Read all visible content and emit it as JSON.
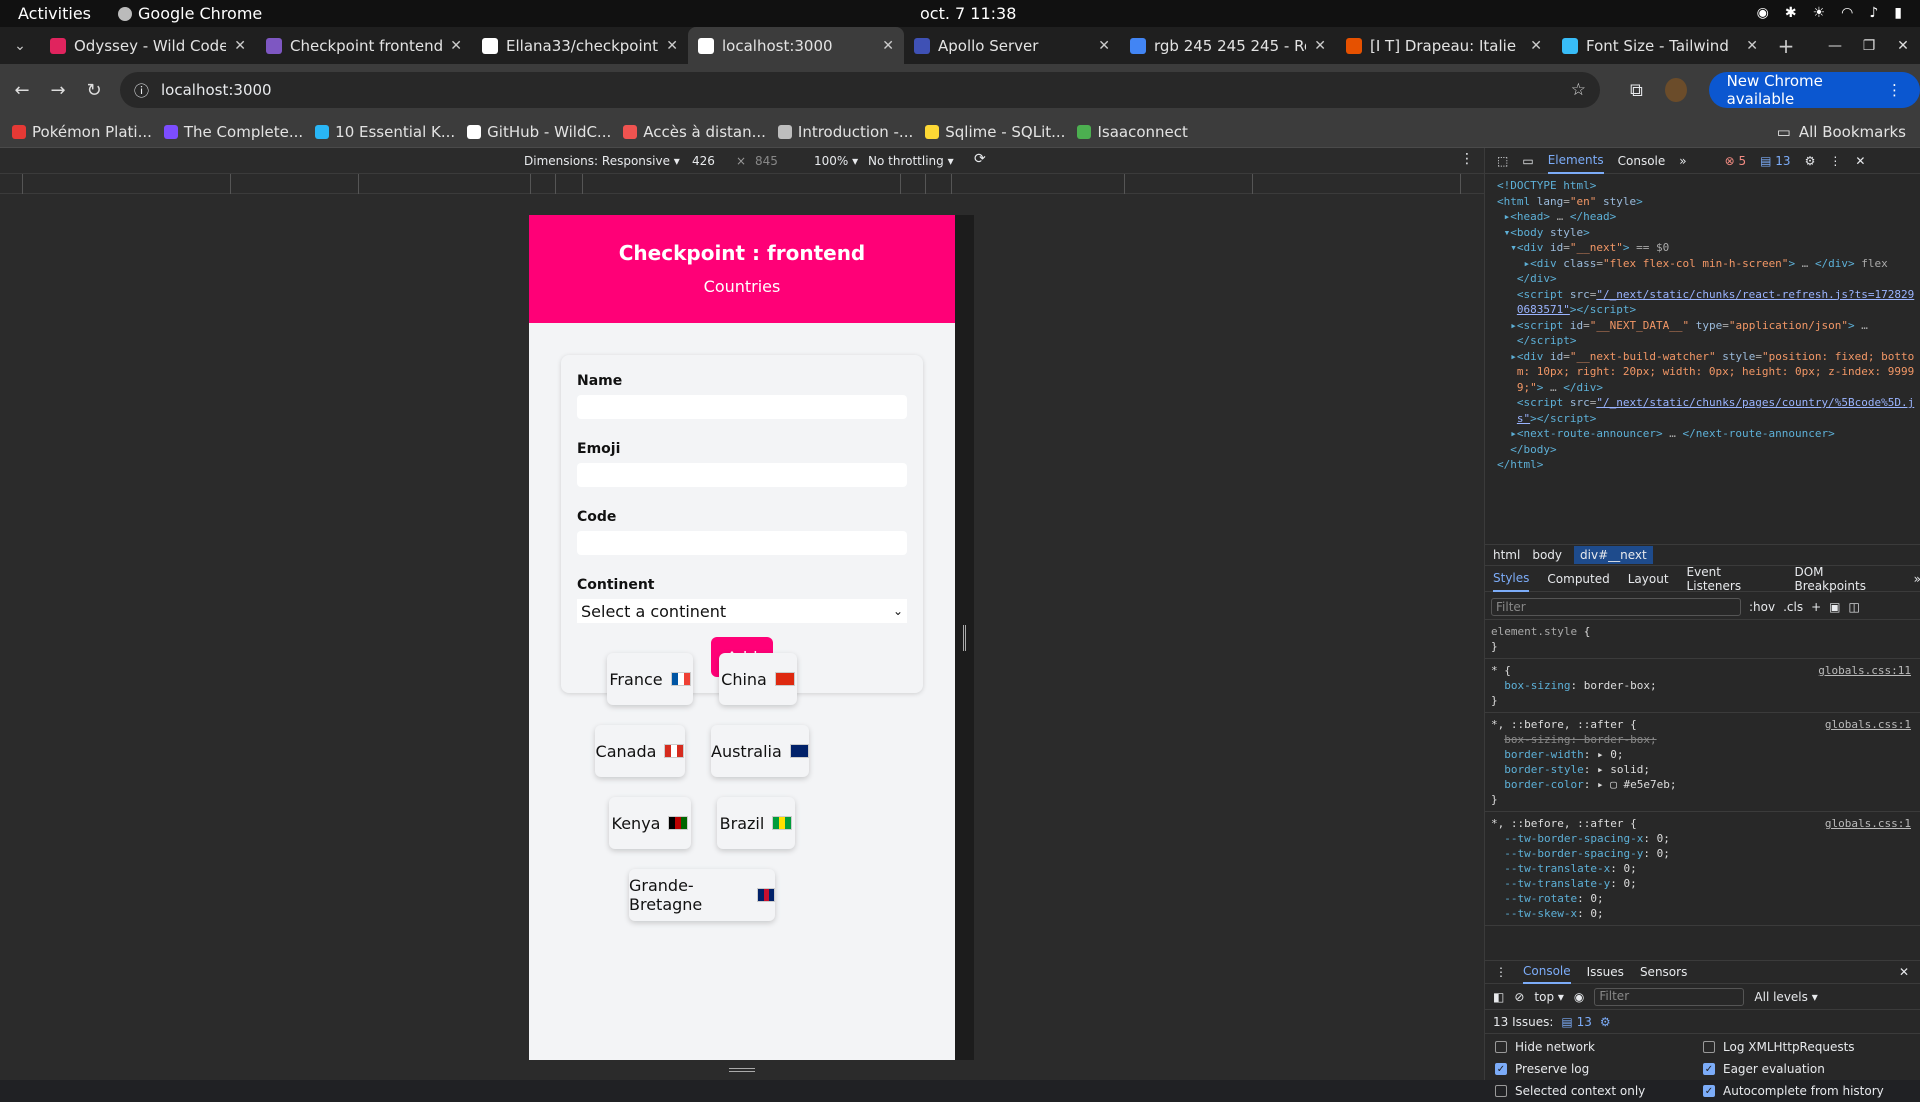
{
  "system": {
    "activities": "Activities",
    "app_name": "Google Chrome",
    "clock": "oct. 7  11:38"
  },
  "tabs": [
    {
      "title": "Odyssey - Wild Code",
      "color": "#e0245e"
    },
    {
      "title": "Checkpoint frontend",
      "color": "#7e57c2"
    },
    {
      "title": "Ellana33/checkpoint",
      "color": "#ffffff"
    },
    {
      "title": "localhost:3000",
      "color": "#ffffff",
      "active": true
    },
    {
      "title": "Apollo Server",
      "color": "#3f51b5"
    },
    {
      "title": "rgb 245 245 245 - Re",
      "color": "#4285f4"
    },
    {
      "title": "[I T] Drapeau: Italie",
      "color": "#e65100"
    },
    {
      "title": "Font Size - Tailwind",
      "color": "#38bdf8"
    }
  ],
  "toolbar": {
    "url": "localhost:3000",
    "new_chrome": "New Chrome available"
  },
  "bookmarks": [
    {
      "label": "Pokémon Plati...",
      "color": "#e53935"
    },
    {
      "label": "The Complete...",
      "color": "#7c4dff"
    },
    {
      "label": "10 Essential K...",
      "color": "#29b6f6"
    },
    {
      "label": "GitHub - WildC...",
      "color": "#ffffff"
    },
    {
      "label": "Accès à distan...",
      "color": "#ef5350"
    },
    {
      "label": "Introduction -...",
      "color": "#bdbdbd"
    },
    {
      "label": "Sqlime - SQLit...",
      "color": "#fdd835"
    },
    {
      "label": "Isaaconnect",
      "color": "#4caf50"
    }
  ],
  "bookmarks_all": "All Bookmarks",
  "device": {
    "dimensions": "Dimensions: Responsive",
    "width": "426",
    "times": "×",
    "height": "845",
    "zoom": "100%",
    "throttle": "No throttling"
  },
  "app": {
    "title": "Checkpoint : frontend",
    "subtitle": "Countries",
    "form": {
      "name_label": "Name",
      "emoji_label": "Emoji",
      "code_label": "Code",
      "continent_label": "Continent",
      "continent_value": "Select a continent",
      "add_button": "Add"
    },
    "countries": [
      {
        "name": "France",
        "flag": [
          "#0055a4",
          "#ffffff",
          "#ef4135"
        ]
      },
      {
        "name": "China",
        "flag": [
          "#de2910",
          "#de2910",
          "#de2910"
        ]
      },
      {
        "name": "Canada",
        "flag": [
          "#d52b1e",
          "#ffffff",
          "#d52b1e"
        ]
      },
      {
        "name": "Australia",
        "flag": [
          "#012169",
          "#012169",
          "#012169"
        ]
      },
      {
        "name": "Kenya",
        "flag": [
          "#000000",
          "#bb0000",
          "#006600"
        ]
      },
      {
        "name": "Brazil",
        "flag": [
          "#009c3b",
          "#ffdf00",
          "#009c3b"
        ]
      },
      {
        "name": "Grande-Bretagne",
        "flag": [
          "#012169",
          "#c8102e",
          "#012169"
        ]
      }
    ]
  },
  "devtools": {
    "tabs": [
      "Elements",
      "Console"
    ],
    "errors": "5",
    "messages": "13",
    "breadcrumb": [
      "html",
      "body",
      "div#__next"
    ],
    "subtabs": [
      "Styles",
      "Computed",
      "Layout",
      "Event Listeners",
      "DOM Breakpoints"
    ],
    "filter": "Filter",
    "hov": ":hov",
    "cls": ".cls",
    "console_tabs": [
      "Console",
      "Issues",
      "Sensors"
    ],
    "context": "top",
    "levels": "All levels",
    "issues": "13 Issues:",
    "issues_count": "13",
    "options": [
      {
        "label": "Hide network",
        "checked": false
      },
      {
        "label": "Log XMLHttpRequests",
        "checked": false
      },
      {
        "label": "Preserve log",
        "checked": true
      },
      {
        "label": "Eager evaluation",
        "checked": true
      },
      {
        "label": "Selected context only",
        "checked": false
      },
      {
        "label": "Autocomplete from history",
        "checked": true
      }
    ]
  }
}
